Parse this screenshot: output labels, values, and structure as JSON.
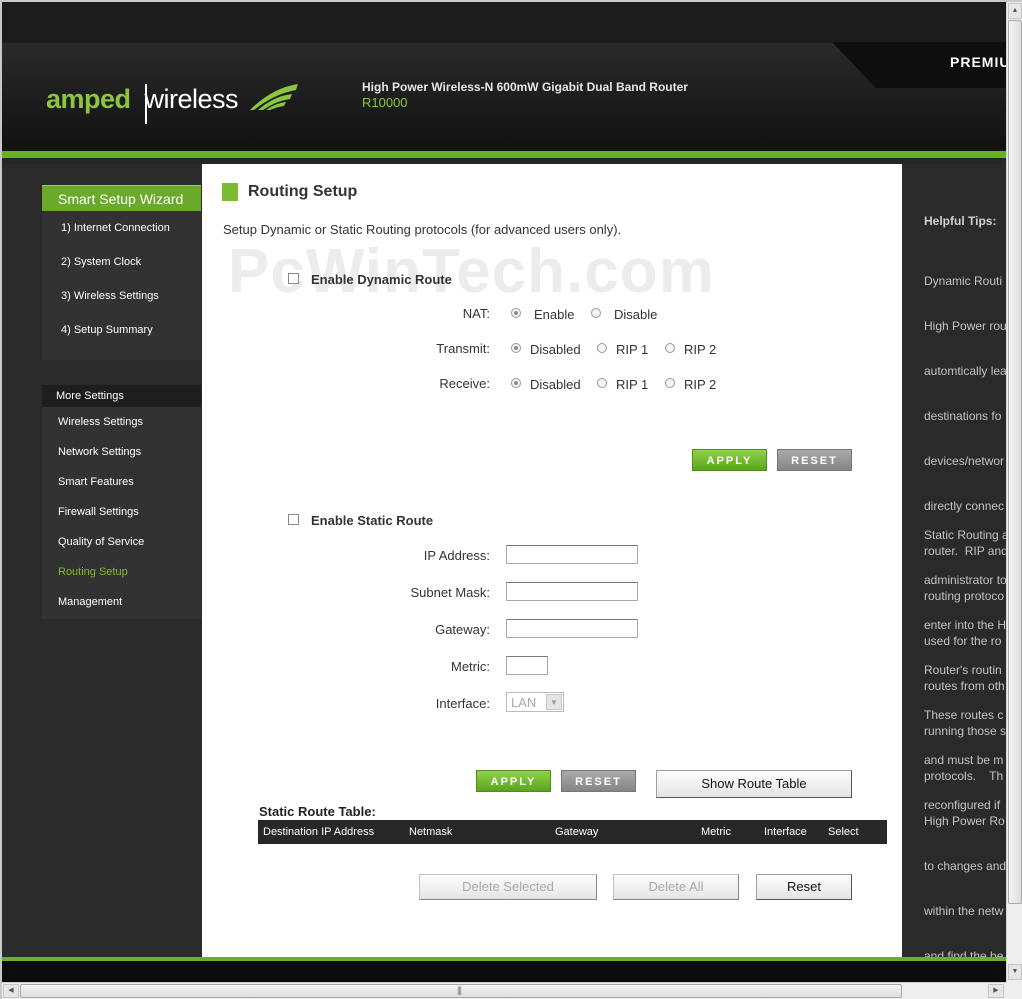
{
  "header": {
    "logo_left": "amped",
    "logo_right": "wireless",
    "product_title": "High Power Wireless-N 600mW Gigabit Dual Band Router",
    "product_model": "R10000",
    "premium_label": "PREMIU"
  },
  "watermark": "PcWinTech.com",
  "sidebar": {
    "wizard_title": "Smart Setup Wizard",
    "wizard_items": [
      "1) Internet Connection",
      "2) System Clock",
      "3) Wireless Settings",
      "4) Setup Summary"
    ],
    "more_title": "More Settings",
    "more_items": [
      "Wireless Settings",
      "Network Settings",
      "Smart Features",
      "Firewall Settings",
      "Quality of Service",
      "Routing Setup",
      "Management"
    ],
    "active_item": "Routing Setup"
  },
  "main": {
    "title": "Routing Setup",
    "description": "Setup Dynamic or Static Routing protocols (for advanced users only).",
    "dynamic": {
      "label": "Enable Dynamic Route",
      "checked": false,
      "nat_label": "NAT:",
      "nat_options": [
        "Enable",
        "Disable"
      ],
      "nat_selected": "Enable",
      "transmit_label": "Transmit:",
      "transmit_options": [
        "Disabled",
        "RIP 1",
        "RIP 2"
      ],
      "transmit_selected": "Disabled",
      "receive_label": "Receive:",
      "receive_options": [
        "Disabled",
        "RIP 1",
        "RIP 2"
      ],
      "receive_selected": "Disabled",
      "apply_label": "APPLY",
      "reset_label": "RESET"
    },
    "static": {
      "label": "Enable Static Route",
      "checked": false,
      "ip_label": "IP Address:",
      "ip_value": "",
      "subnet_label": "Subnet Mask:",
      "subnet_value": "",
      "gateway_label": "Gateway:",
      "gateway_value": "",
      "metric_label": "Metric:",
      "metric_value": "",
      "interface_label": "Interface:",
      "interface_value": "LAN",
      "apply_label": "APPLY",
      "reset_label": "RESET",
      "show_table_label": "Show Route Table"
    },
    "route_table": {
      "title": "Static Route Table:",
      "columns": [
        "Destination IP Address",
        "Netmask",
        "Gateway",
        "Metric",
        "Interface",
        "Select"
      ],
      "rows": [],
      "delete_selected_label": "Delete Selected",
      "delete_all_label": "Delete All",
      "reset_label": "Reset"
    }
  },
  "tips": {
    "title": "Helpful Tips:",
    "paragraph1_lines": [
      "Dynamic Routi",
      "High Power rou",
      "automtically lea",
      "destinations fo",
      "devices/networ",
      "directly connec",
      "router.  RIP and",
      "routing protoco",
      "used for the ro",
      "routes from oth",
      "running those s",
      "protocols.    Th",
      "High Power Ro",
      "to changes and",
      "within the netw",
      "and find the be"
    ],
    "paragraph2_lines": [
      "Static Routing a",
      "administrator to",
      "enter into the H",
      "Router's routin",
      "These routes c",
      "and must be m",
      "reconfigured if"
    ]
  },
  "colors": {
    "brand_green": "#7dbb32",
    "header_dark": "#1b1b1b",
    "sidebar_dark": "#2a2a2a"
  }
}
